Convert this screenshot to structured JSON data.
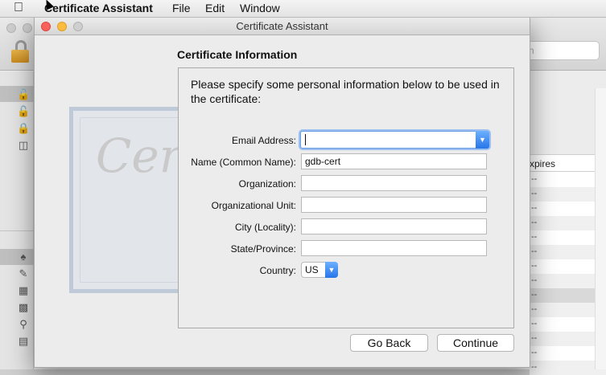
{
  "menubar": {
    "apple_icon": "apple-logo",
    "app_name": "Certificate Assistant",
    "items": [
      "File",
      "Edit",
      "Window"
    ]
  },
  "background_window": {
    "search_placeholder": "ch",
    "table_header": "xpires",
    "row_text": "--"
  },
  "dialog": {
    "title": "Certificate Assistant",
    "section_title": "Certificate Information",
    "intro": "Please specify some personal information below to be used in the certificate:",
    "watermark_text": "Certificate",
    "fields": {
      "email": {
        "label": "Email Address:",
        "value": ""
      },
      "name": {
        "label": "Name (Common Name):",
        "value": "gdb-cert"
      },
      "organization": {
        "label": "Organization:",
        "value": ""
      },
      "org_unit": {
        "label": "Organizational Unit:",
        "value": ""
      },
      "city": {
        "label": "City (Locality):",
        "value": ""
      },
      "state": {
        "label": "State/Province:",
        "value": ""
      },
      "country": {
        "label": "Country:",
        "value": "US"
      }
    },
    "buttons": {
      "go_back": "Go Back",
      "continue": "Continue"
    }
  }
}
